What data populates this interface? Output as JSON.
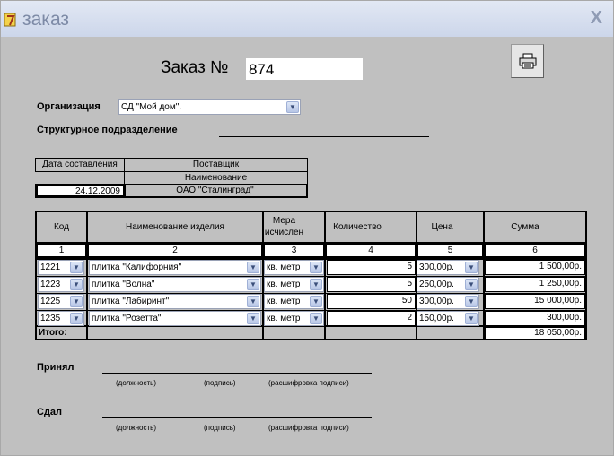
{
  "window": {
    "title": "заказ",
    "close_glyph": "X"
  },
  "order": {
    "heading": "Заказ №",
    "number": "874"
  },
  "org": {
    "label": "Организация",
    "value": "СД \"Мой дом\"."
  },
  "subdivision": {
    "label": "Структурное подразделение"
  },
  "supplier": {
    "date_header": "Дата составления",
    "supplier_header": "Поставщик",
    "name_header": "Наименование",
    "date": "24.12.2009",
    "name": "ОАО \"Сталинград\""
  },
  "items": {
    "headers": [
      "Код",
      "Наименование изделия",
      "Мера исчислен",
      "Количество",
      "Цена",
      "Сумма"
    ],
    "col_numbers": [
      "1",
      "2",
      "3",
      "4",
      "5",
      "6"
    ],
    "rows": [
      {
        "code": "1221",
        "name": "плитка \"Калифорния\"",
        "unit": "кв. метр",
        "qty": "5",
        "price": "300,00р.",
        "sum": "1 500,00р."
      },
      {
        "code": "1223",
        "name": "плитка \"Волна\"",
        "unit": "кв. метр",
        "qty": "5",
        "price": "250,00р.",
        "sum": "1 250,00р."
      },
      {
        "code": "1225",
        "name": "плитка \"Лабиринт\"",
        "unit": "кв. метр",
        "qty": "50",
        "price": "300,00р.",
        "sum": "15 000,00р."
      },
      {
        "code": "1235",
        "name": "плитка \"Розетта\"",
        "unit": "кв. метр",
        "qty": "2",
        "price": "150,00р.",
        "sum": "300,00р."
      }
    ],
    "total_label": "Итого:",
    "total": "18 050,00р."
  },
  "signatures": {
    "accepted": "Принял",
    "handed": "Сдал",
    "position": "(должность)",
    "sign": "(подпись)",
    "decode": "(расшифровка подписи)"
  },
  "icons": {
    "print": "printer-icon",
    "dropdown": "chevron-down-icon",
    "app": "app-icon",
    "close": "close-icon"
  },
  "colors": {
    "background": "#c0c0c0",
    "title_text": "#7d8aa6"
  }
}
